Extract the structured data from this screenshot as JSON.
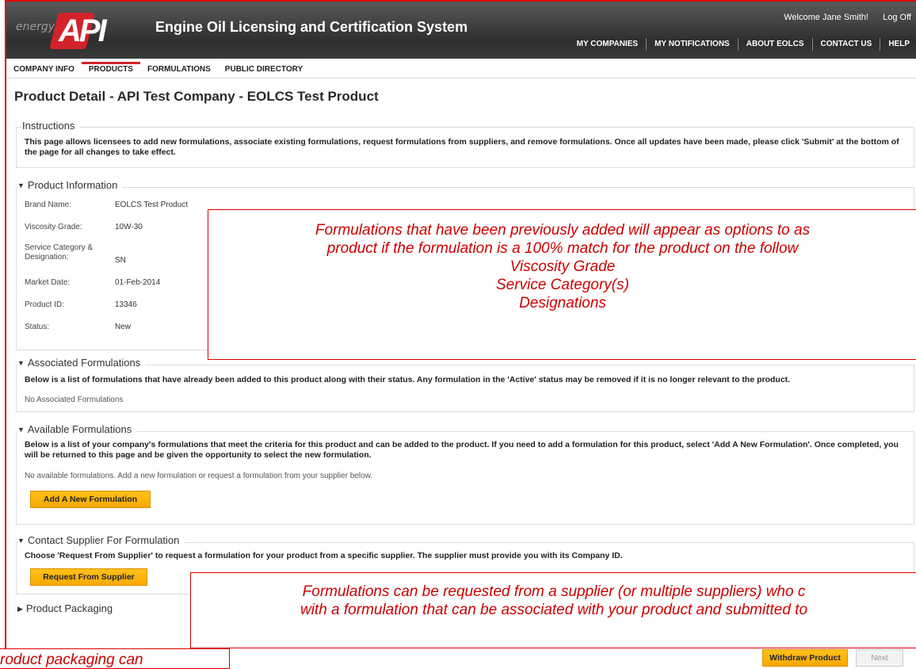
{
  "header": {
    "logo_word": "energy",
    "logo_letters": "API",
    "app_title": "Engine Oil Licensing and Certification System",
    "welcome": "Welcome  Jane Smith!",
    "logoff": "Log Off",
    "nav": [
      "MY COMPANIES",
      "MY NOTIFICATIONS",
      "ABOUT EOLCS",
      "CONTACT US",
      "HELP"
    ]
  },
  "tabs": [
    "COMPANY INFO",
    "PRODUCTS",
    "FORMULATIONS",
    "PUBLIC DIRECTORY"
  ],
  "page_title": "Product Detail - API Test Company - EOLCS Test Product",
  "instructions": {
    "legend": "Instructions",
    "text": "This page allows licensees to add new formulations, associate existing formulations, request formulations from suppliers, and remove formulations. Once all updates have been made, please click 'Submit' at the bottom of the page for all changes to take effect."
  },
  "product_info": {
    "legend": "Product Information",
    "rows": [
      {
        "label": "Brand Name:",
        "value": "EOLCS Test Product"
      },
      {
        "label": "Viscosity Grade:",
        "value": "10W-30"
      },
      {
        "label": "Service Category & Designation:",
        "value": "SN"
      },
      {
        "label": "Market Date:",
        "value": "01-Feb-2014"
      },
      {
        "label": "Product ID:",
        "value": "13346"
      },
      {
        "label": "Status:",
        "value": "New"
      }
    ]
  },
  "associated": {
    "legend": "Associated Formulations",
    "text": "Below is a list of formulations that have already been added to this product along with their status. Any formulation in the 'Active' status may be removed if it is no longer relevant to the product.",
    "empty": "No Associated Formulations"
  },
  "available": {
    "legend": "Available Formulations",
    "text": "Below is a list of your company's formulations that meet the criteria for this product and can be added to the product. If you need to add a formulation for this product, select 'Add A New Formulation'. Once completed, you will be returned to this page and be given the opportunity to select the new formulation.",
    "empty": "No available formulations. Add a new formulation or request a formulation from your supplier below.",
    "button": "Add A New Formulation"
  },
  "supplier": {
    "legend": "Contact Supplier For Formulation",
    "text": "Choose 'Request From Supplier' to request a formulation for your product from a specific supplier. The supplier must provide you with its Company ID.",
    "button": "Request From Supplier"
  },
  "packaging": {
    "legend": "Product Packaging"
  },
  "footer": {
    "withdraw": "Withdraw Product",
    "next": "Next"
  },
  "callouts": {
    "top": [
      "Formulations that have been previously added will appear as options to as",
      "product if the formulation is a 100% match for the product on the follow",
      "Viscosity Grade",
      "Service Category(s)",
      "Designations"
    ],
    "middle": [
      "Formulations can be requested from a supplier (or multiple suppliers) who c",
      "with a formulation that can be associated with your product and submitted to"
    ],
    "bottom": "roduct packaging can"
  },
  "colors": {
    "accent": "#d2232a",
    "button": "#f7a800",
    "callout": "#cc0000"
  }
}
